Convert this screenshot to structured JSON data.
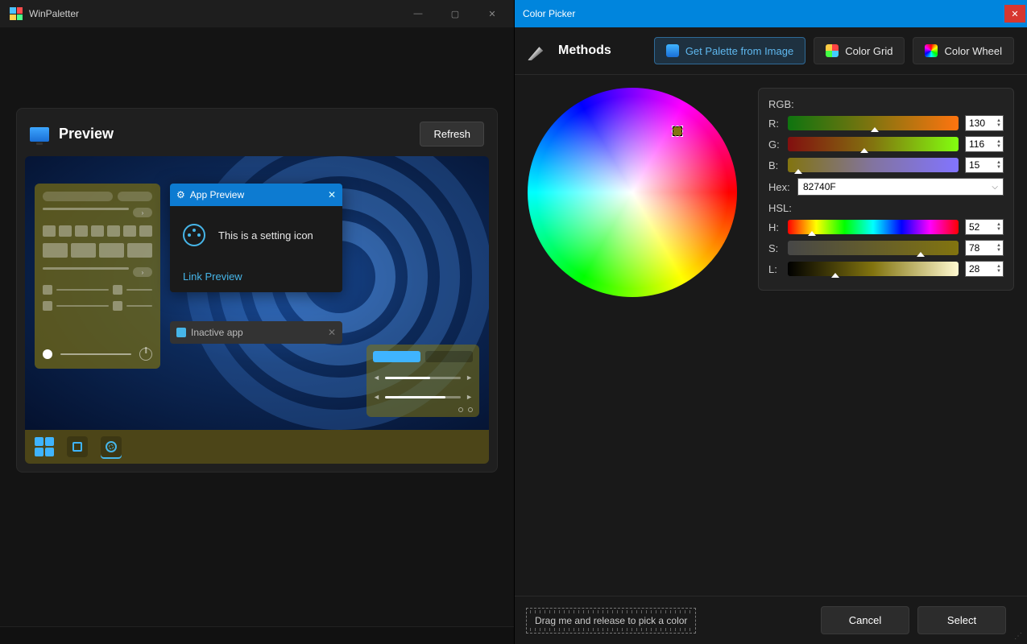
{
  "left": {
    "title": "WinPaletter",
    "preview_title": "Preview",
    "refresh": "Refresh",
    "app_preview_title": "App Preview",
    "setting_text": "This is a setting icon",
    "link_text": "Link Preview",
    "inactive_title": "Inactive app"
  },
  "picker": {
    "title": "Color Picker",
    "methods_label": "Methods",
    "btn_palette": "Get Palette from Image",
    "btn_grid": "Color Grid",
    "btn_wheel": "Color Wheel",
    "rgb_label": "RGB:",
    "r": "R:",
    "r_val": "130",
    "g": "G:",
    "g_val": "116",
    "b": "B:",
    "b_val": "15",
    "hex_label": "Hex:",
    "hex_val": "82740F",
    "hsl_label": "HSL:",
    "h": "H:",
    "h_val": "52",
    "s": "S:",
    "s_val": "78",
    "l": "L:",
    "l_val": "28",
    "drag_hint": "Drag me and release to pick a color",
    "cancel": "Cancel",
    "select": "Select"
  }
}
